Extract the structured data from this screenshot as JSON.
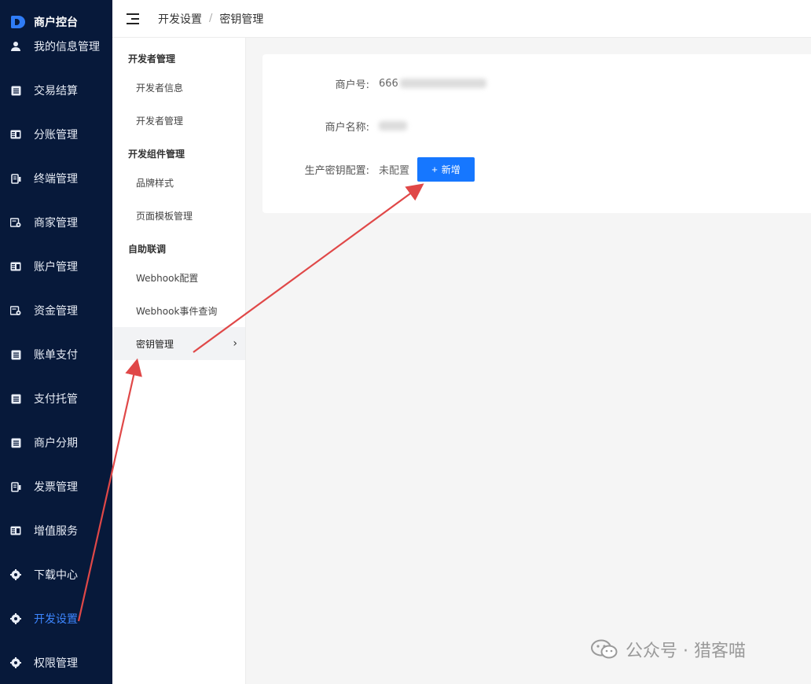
{
  "sidebar": {
    "brand": "商户控台",
    "items": [
      {
        "label": "我的信息管理",
        "icon": "user-icon",
        "active": false
      },
      {
        "label": "交易结算",
        "icon": "list-icon",
        "active": false
      },
      {
        "label": "分账管理",
        "icon": "card-list-icon",
        "active": false
      },
      {
        "label": "终端管理",
        "icon": "terminal-icon",
        "active": false
      },
      {
        "label": "商家管理",
        "icon": "merchant-icon",
        "active": false
      },
      {
        "label": "账户管理",
        "icon": "card-list-icon",
        "active": false
      },
      {
        "label": "资金管理",
        "icon": "merchant-icon",
        "active": false
      },
      {
        "label": "账单支付",
        "icon": "list-icon",
        "active": false
      },
      {
        "label": "支付托管",
        "icon": "list-icon",
        "active": false
      },
      {
        "label": "商户分期",
        "icon": "list-icon",
        "active": false
      },
      {
        "label": "发票管理",
        "icon": "terminal-icon",
        "active": false
      },
      {
        "label": "增值服务",
        "icon": "card-list-icon",
        "active": false
      },
      {
        "label": "下载中心",
        "icon": "gear-icon",
        "active": false
      },
      {
        "label": "开发设置",
        "icon": "gear-icon",
        "active": true
      },
      {
        "label": "权限管理",
        "icon": "gear-icon",
        "active": false
      }
    ]
  },
  "header": {
    "breadcrumb": [
      "开发设置",
      "密钥管理"
    ],
    "separator": "/"
  },
  "submenu": {
    "groups": [
      {
        "title": "开发者管理",
        "items": [
          {
            "label": "开发者信息"
          },
          {
            "label": "开发者管理"
          }
        ]
      },
      {
        "title": "开发组件管理",
        "items": [
          {
            "label": "品牌样式"
          },
          {
            "label": "页面模板管理"
          }
        ]
      },
      {
        "title": "自助联调",
        "items": [
          {
            "label": "Webhook配置"
          },
          {
            "label": "Webhook事件查询"
          }
        ]
      }
    ],
    "active_item": {
      "label": "密钥管理",
      "chevron": "›"
    }
  },
  "card": {
    "merchant_no_label": "商户号:",
    "merchant_no_visible": "666",
    "merchant_name_label": "商户名称:",
    "key_config_label": "生产密钥配置:",
    "key_config_value": "未配置",
    "add_button": "新增",
    "add_button_icon": "+"
  },
  "watermark": {
    "text": "公众号 · 猎客喵"
  },
  "colors": {
    "sidebar_bg": "#07193a",
    "accent": "#1677ff",
    "active_text": "#3d86ff",
    "annotation_arrow": "#e04848"
  }
}
